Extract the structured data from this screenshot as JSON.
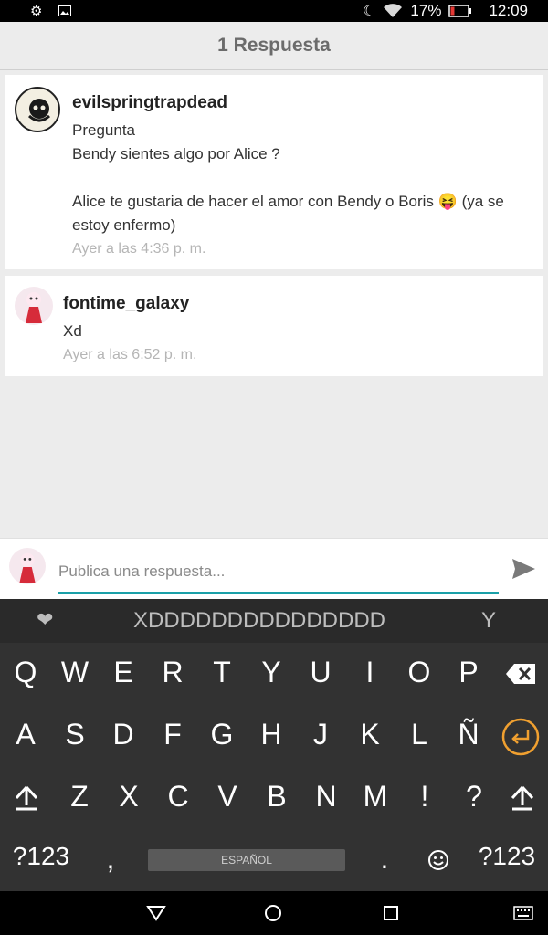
{
  "status_bar": {
    "battery": "17%",
    "time": "12:09"
  },
  "header": {
    "title": "1 Respuesta"
  },
  "comments": [
    {
      "username": "evilspringtrapdead",
      "lines": [
        "Pregunta",
        "Bendy sientes algo por Alice ?",
        "",
        "Alice te gustaria de hacer el amor con Bendy o Boris",
        "estoy enfermo)"
      ],
      "emoji": "😝",
      "line4_suffix": "(ya se",
      "time": "Ayer a las 4:36 p. m."
    },
    {
      "username": "fontime_galaxy",
      "text": "Xd",
      "time": "Ayer a las 6:52 p. m."
    }
  ],
  "reply": {
    "placeholder": "Publica una respuesta..."
  },
  "keyboard": {
    "suggestion_main": "XDDDDDDDDDDDDDDD",
    "suggestion_right": "Y",
    "row1": [
      "Q",
      "W",
      "E",
      "R",
      "T",
      "Y",
      "U",
      "I",
      "O",
      "P"
    ],
    "row2": [
      "A",
      "S",
      "D",
      "F",
      "G",
      "H",
      "J",
      "K",
      "L",
      "Ñ"
    ],
    "row3": [
      "Z",
      "X",
      "C",
      "V",
      "B",
      "N",
      "M",
      "!",
      "?"
    ],
    "symbols_label": "?123",
    "comma": ",",
    "period": ".",
    "space_label": "ESPAÑOL"
  },
  "colors": {
    "accent": "#1aa0a8",
    "enter_key": "#f0a030",
    "battery_low": "#e53935"
  }
}
